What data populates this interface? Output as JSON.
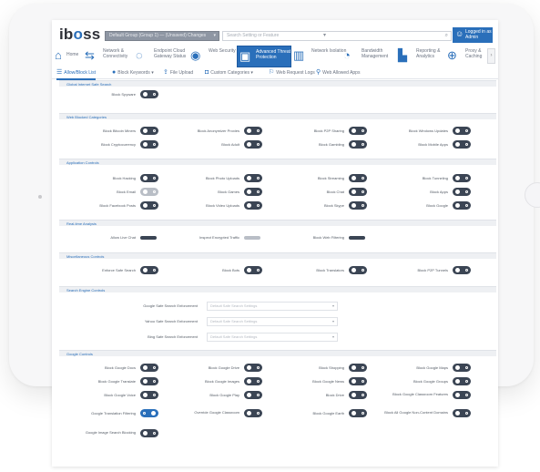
{
  "app": {
    "logo": "iboss",
    "group_select": "Default Group (Group 1) — (Unsaved) Changes",
    "search_placeholder": "Search Setting or Feature",
    "search_dropdown": "▾",
    "user_label": "Logged in as Admin"
  },
  "modules": [
    {
      "label": "Home",
      "icon": "home-icon"
    },
    {
      "label": "Network & Connectivity",
      "icon": "network-icon"
    },
    {
      "label": "Endpoint Cloud Gateway Status",
      "icon": "gateway-icon"
    },
    {
      "label": "Web Security",
      "icon": "shield-icon"
    },
    {
      "label": "Advanced Threat Protection",
      "icon": "threat-icon"
    },
    {
      "label": "Network Isolation",
      "icon": "isolation-icon"
    },
    {
      "label": "Bandwidth Management",
      "icon": "gauge-icon"
    },
    {
      "label": "Reporting & Analytics",
      "icon": "chart-icon"
    },
    {
      "label": "Proxy & Caching",
      "icon": "proxy-icon"
    }
  ],
  "subnav": [
    {
      "label": "Allow/Block List",
      "icon": "list-icon"
    },
    {
      "label": "Block Keywords ▾",
      "icon": "key-icon"
    },
    {
      "label": "File Upload",
      "icon": "upload-icon"
    },
    {
      "label": "Custom Categories ▾",
      "icon": "category-icon"
    },
    {
      "label": "Web Request Logs",
      "icon": "log-icon"
    },
    {
      "label": "Web Allowed Apps",
      "icon": "app-icon"
    }
  ],
  "sections": {
    "s1": "Global Internet Safe Search",
    "s2": "Web Blocked Categories",
    "s3": "Application Controls",
    "s4": "Real-time Analysis",
    "s5": "Miscellaneous Controls",
    "s6": "Search Engine Controls",
    "s7": "Google Controls"
  },
  "rows": {
    "s1": [
      [
        "Block Spyware"
      ]
    ],
    "s2": [
      [
        "Block Bitcoin Miners",
        "Block Anonymizer Proxies",
        "Block P2P Sharing",
        "Block Windows Updates"
      ],
      [
        "Block Cryptocurrency",
        "Block Adult",
        "Block Gambling",
        "Block Mobile Apps"
      ]
    ],
    "s3": [
      [
        "Block Hacking",
        "Block Photo Uploads",
        "Block Streaming",
        "Block Tunneling"
      ],
      [
        "Block Email",
        "Block Games",
        "Block Chat",
        "Block Apps"
      ],
      [
        "Block Facebook Posts",
        "Block Video Uploads",
        "Block Skype",
        "Block Google"
      ]
    ],
    "s4": [
      [
        "Allow Live Chat",
        "Inspect Encrypted Traffic",
        "Block Web Filtering"
      ]
    ],
    "s5": [
      [
        "Enforce Safe Search",
        "Block Bots",
        "Block Translators",
        "Block P2P Tunnels"
      ]
    ],
    "s6": [
      "Google Safe Search Enforcement",
      "Yahoo Safe Search Enforcement",
      "Bing Safe Search Enforcement"
    ],
    "s6_placeholder": "Default Safe Search Settings",
    "s7": [
      [
        "Block Google Docs",
        "Block Google Drive",
        "Block Shopping",
        "Block Google Maps"
      ],
      [
        "Block Google Translate",
        "Block Google Images",
        "Block Google News",
        "Block Google Groups"
      ],
      [
        "Block Google Voice",
        "Block Google Play",
        "Block Drive",
        "Block Google Classroom Features"
      ],
      [
        "Google Translation Filtering",
        "Override Google Classroom",
        "Block Google Earth",
        "Block All Google Non-Content Domains"
      ],
      [
        "Google Image Search Blocking"
      ]
    ]
  }
}
